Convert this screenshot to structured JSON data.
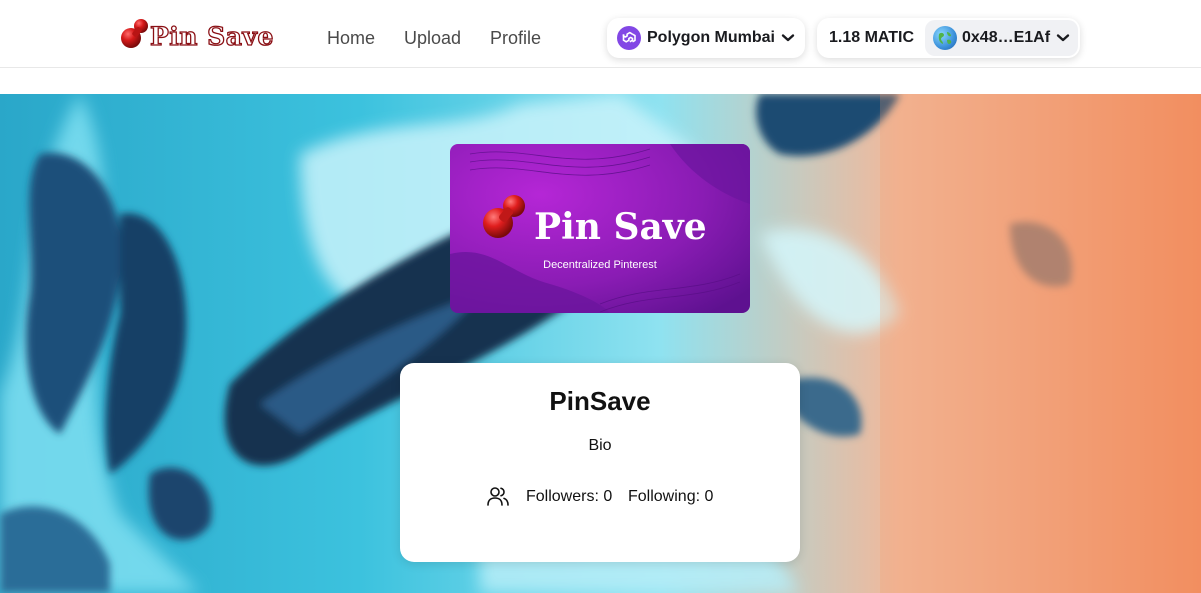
{
  "header": {
    "logo_text": "Pin Save",
    "nav": {
      "home": "Home",
      "upload": "Upload",
      "profile": "Profile"
    },
    "network": {
      "label": "Polygon Mumbai",
      "icon": "polygon-icon",
      "color": "#8247e5"
    },
    "account": {
      "balance": "1.18 MATIC",
      "address": "0x48…E1Af",
      "avatar_icon": "globe-avatar"
    }
  },
  "banner": {
    "logo_text": "Pin Save",
    "tagline": "Decentralized Pinterest",
    "color": "#8a1fb8"
  },
  "profile": {
    "name": "PinSave",
    "bio": "Bio",
    "followers": "Followers: 0",
    "following": "Following: 0"
  }
}
